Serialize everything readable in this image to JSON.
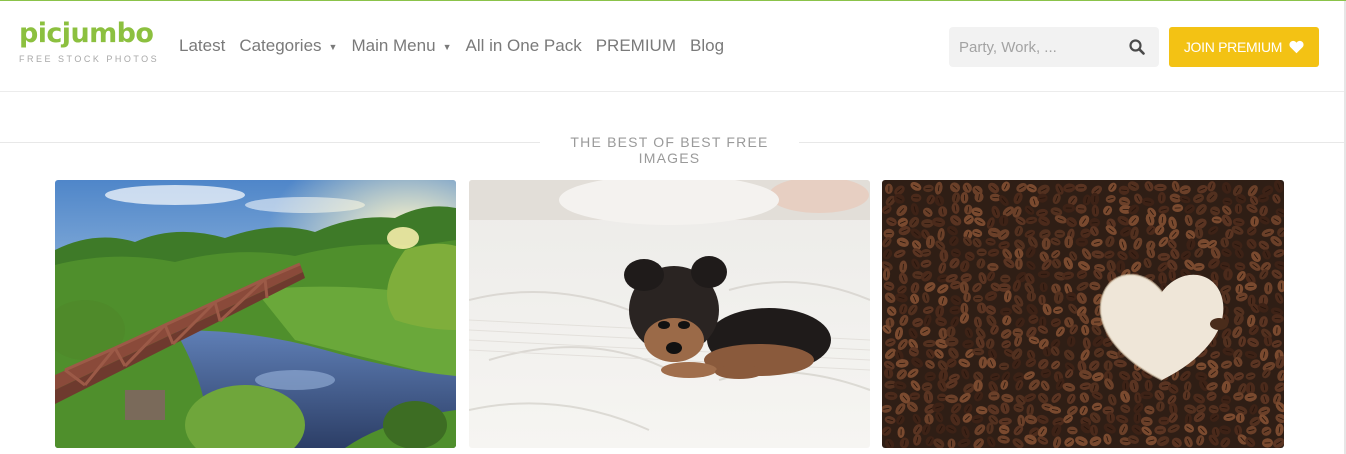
{
  "brand": {
    "name": "picjumbo",
    "tagline": "FREE STOCK PHOTOS",
    "accent_color": "#8cc03f"
  },
  "nav": {
    "items": [
      {
        "label": "Latest",
        "has_dropdown": false
      },
      {
        "label": "Categories",
        "has_dropdown": true
      },
      {
        "label": "Main Menu",
        "has_dropdown": true
      },
      {
        "label": "All in One Pack",
        "has_dropdown": false
      },
      {
        "label": "PREMIUM",
        "has_dropdown": false
      },
      {
        "label": "Blog",
        "has_dropdown": false
      }
    ],
    "dropdown_icon": "caret-down-icon"
  },
  "search": {
    "placeholder": "Party, Work, ...",
    "value": "",
    "icon": "search-icon"
  },
  "join_button": {
    "label": "JOIN PREMIUM",
    "icon": "heart-icon",
    "color": "#f3c214"
  },
  "section": {
    "title": "THE BEST OF BEST FREE IMAGES"
  },
  "photos": [
    {
      "subject": "Rusty railway bridge over a river with green trees"
    },
    {
      "subject": "Yorkshire terrier puppy lying on white bed sheets"
    },
    {
      "subject": "Coffee beans with heart-shaped empty space"
    }
  ]
}
